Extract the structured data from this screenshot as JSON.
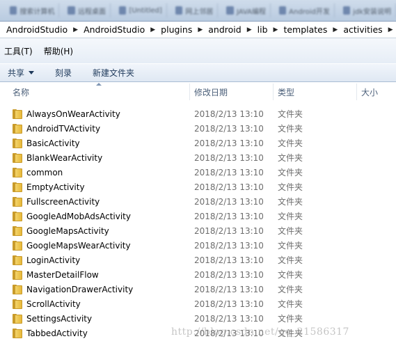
{
  "taskbar": {
    "tabs": [
      "搜索计算机",
      "远程桌面",
      "[Untitled]",
      "网上邻居",
      "JAVA编程",
      "Android开发",
      "jdk安装说明"
    ]
  },
  "address_bar": {
    "segments": [
      "AndroidStudio",
      "AndroidStudio",
      "plugins",
      "android",
      "lib",
      "templates",
      "activities"
    ]
  },
  "menu": {
    "items": [
      "工具(T)",
      "帮助(H)"
    ]
  },
  "toolbar": {
    "share_label": "共享",
    "burn_label": "刻录",
    "new_folder_label": "新建文件夹"
  },
  "columns": {
    "name": "名称",
    "date": "修改日期",
    "type": "类型",
    "size": "大小"
  },
  "files": [
    {
      "name": "AlwaysOnWearActivity",
      "date": "2018/2/13 13:10",
      "type": "文件夹"
    },
    {
      "name": "AndroidTVActivity",
      "date": "2018/2/13 13:10",
      "type": "文件夹"
    },
    {
      "name": "BasicActivity",
      "date": "2018/2/13 13:10",
      "type": "文件夹"
    },
    {
      "name": "BlankWearActivity",
      "date": "2018/2/13 13:10",
      "type": "文件夹"
    },
    {
      "name": "common",
      "date": "2018/2/13 13:10",
      "type": "文件夹"
    },
    {
      "name": "EmptyActivity",
      "date": "2018/2/13 13:10",
      "type": "文件夹"
    },
    {
      "name": "FullscreenActivity",
      "date": "2018/2/13 13:10",
      "type": "文件夹"
    },
    {
      "name": "GoogleAdMobAdsActivity",
      "date": "2018/2/13 13:10",
      "type": "文件夹"
    },
    {
      "name": "GoogleMapsActivity",
      "date": "2018/2/13 13:10",
      "type": "文件夹"
    },
    {
      "name": "GoogleMapsWearActivity",
      "date": "2018/2/13 13:10",
      "type": "文件夹"
    },
    {
      "name": "LoginActivity",
      "date": "2018/2/13 13:10",
      "type": "文件夹"
    },
    {
      "name": "MasterDetailFlow",
      "date": "2018/2/13 13:10",
      "type": "文件夹"
    },
    {
      "name": "NavigationDrawerActivity",
      "date": "2018/2/13 13:10",
      "type": "文件夹"
    },
    {
      "name": "ScrollActivity",
      "date": "2018/2/13 13:10",
      "type": "文件夹"
    },
    {
      "name": "SettingsActivity",
      "date": "2018/2/13 13:10",
      "type": "文件夹"
    },
    {
      "name": "TabbedActivity",
      "date": "2018/2/13 13:10",
      "type": "文件夹"
    }
  ],
  "watermark": "http://blog.csdn.net/qq_21586317",
  "colors": {
    "folder": "#e7b93a",
    "header_text": "#4c607a",
    "toolbar_text": "#1e395b"
  }
}
